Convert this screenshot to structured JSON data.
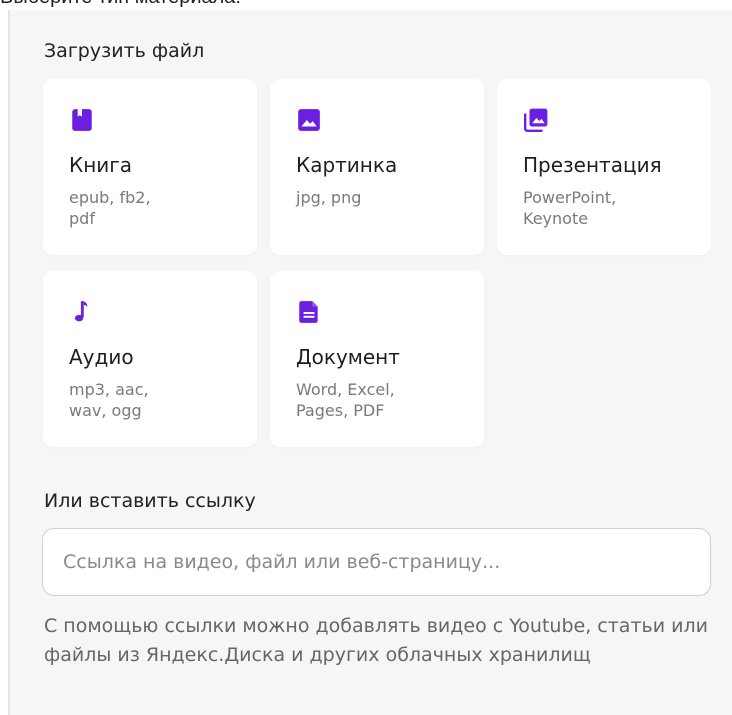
{
  "header": {
    "cut_title": "Выберите тип материала:"
  },
  "upload": {
    "title": "Загрузить файл",
    "cards": [
      {
        "label": "Книга",
        "formats": "epub, fb2,\npdf",
        "icon": "book-icon"
      },
      {
        "label": "Картинка",
        "formats": "jpg, png",
        "icon": "image-icon"
      },
      {
        "label": "Презентация",
        "formats": "PowerPoint,\nKeynote",
        "icon": "presentation-icon"
      },
      {
        "label": "Аудио",
        "formats": "mp3, aac,\nwav, ogg",
        "icon": "music-note-icon"
      },
      {
        "label": "Документ",
        "formats": "Word, Excel,\nPages, PDF",
        "icon": "document-icon"
      }
    ]
  },
  "link": {
    "title": "Или вставить ссылку",
    "placeholder": "Ссылка на видео, файл или веб-страницу...",
    "hint": "С помощью ссылки можно добавлять видео с Youtube, статьи или файлы из Яндекс.Диска и других облачных хранилищ"
  },
  "colors": {
    "accent": "#6b1fe0",
    "panel_bg": "#f6f6f8",
    "card_bg": "#ffffff"
  }
}
